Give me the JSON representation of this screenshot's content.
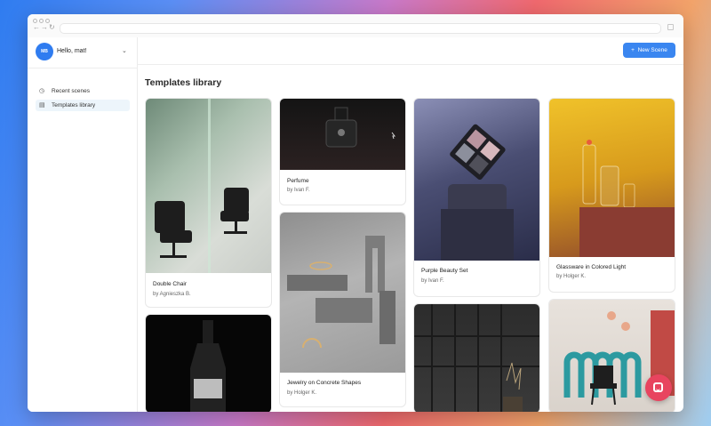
{
  "user": {
    "initials": "MB",
    "greeting": "Hello, mat!"
  },
  "sidebar": {
    "items": [
      {
        "label": "Recent scenes",
        "icon": "clock-icon"
      },
      {
        "label": "Templates library",
        "icon": "library-icon"
      }
    ]
  },
  "header": {
    "new_scene_label": "New Scene",
    "new_scene_icon": "+"
  },
  "main": {
    "title": "Templates library"
  },
  "templates": [
    {
      "title": "Double Chair",
      "author": "by Agnieszka B."
    },
    {
      "title": "Perfume",
      "author": "by Ivan F."
    },
    {
      "title": "Jewelry on Concrete Shapes",
      "author": "by Holger K."
    },
    {
      "title": "Purple Beauty Set",
      "author": "by Ivan F."
    },
    {
      "title": "Glassware in Colored Light",
      "author": "by Holger K."
    },
    {
      "title": "",
      "author": ""
    },
    {
      "title": "",
      "author": ""
    },
    {
      "title": "",
      "author": ""
    }
  ],
  "colors": {
    "accent": "#3a86f0",
    "chat": "#e8445f"
  }
}
